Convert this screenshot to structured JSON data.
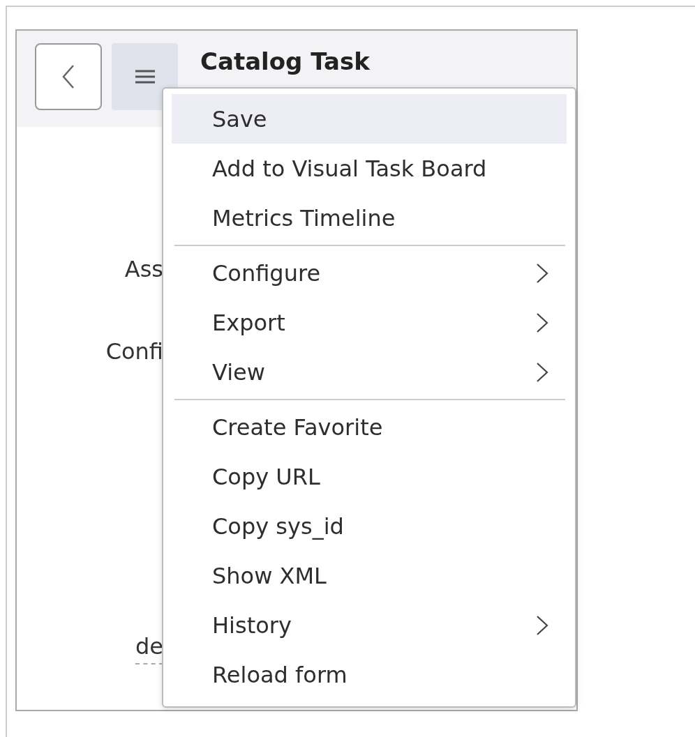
{
  "header": {
    "title": "Catalog Task"
  },
  "form_labels": [
    "Ass",
    "Confi",
    "de"
  ],
  "context_menu": {
    "items": [
      {
        "kind": "item",
        "label": "Save",
        "selected": true,
        "submenu": false
      },
      {
        "kind": "item",
        "label": "Add to Visual Task Board",
        "selected": false,
        "submenu": false
      },
      {
        "kind": "item",
        "label": "Metrics Timeline",
        "selected": false,
        "submenu": false
      },
      {
        "kind": "separator"
      },
      {
        "kind": "item",
        "label": "Configure",
        "selected": false,
        "submenu": true
      },
      {
        "kind": "item",
        "label": "Export",
        "selected": false,
        "submenu": true
      },
      {
        "kind": "item",
        "label": "View",
        "selected": false,
        "submenu": true
      },
      {
        "kind": "separator"
      },
      {
        "kind": "item",
        "label": "Create Favorite",
        "selected": false,
        "submenu": false
      },
      {
        "kind": "item",
        "label": "Copy URL",
        "selected": false,
        "submenu": false
      },
      {
        "kind": "item",
        "label": "Copy sys_id",
        "selected": false,
        "submenu": false
      },
      {
        "kind": "item",
        "label": "Show XML",
        "selected": false,
        "submenu": false
      },
      {
        "kind": "item",
        "label": "History",
        "selected": false,
        "submenu": true
      },
      {
        "kind": "item",
        "label": "Reload form",
        "selected": false,
        "submenu": false
      }
    ]
  }
}
